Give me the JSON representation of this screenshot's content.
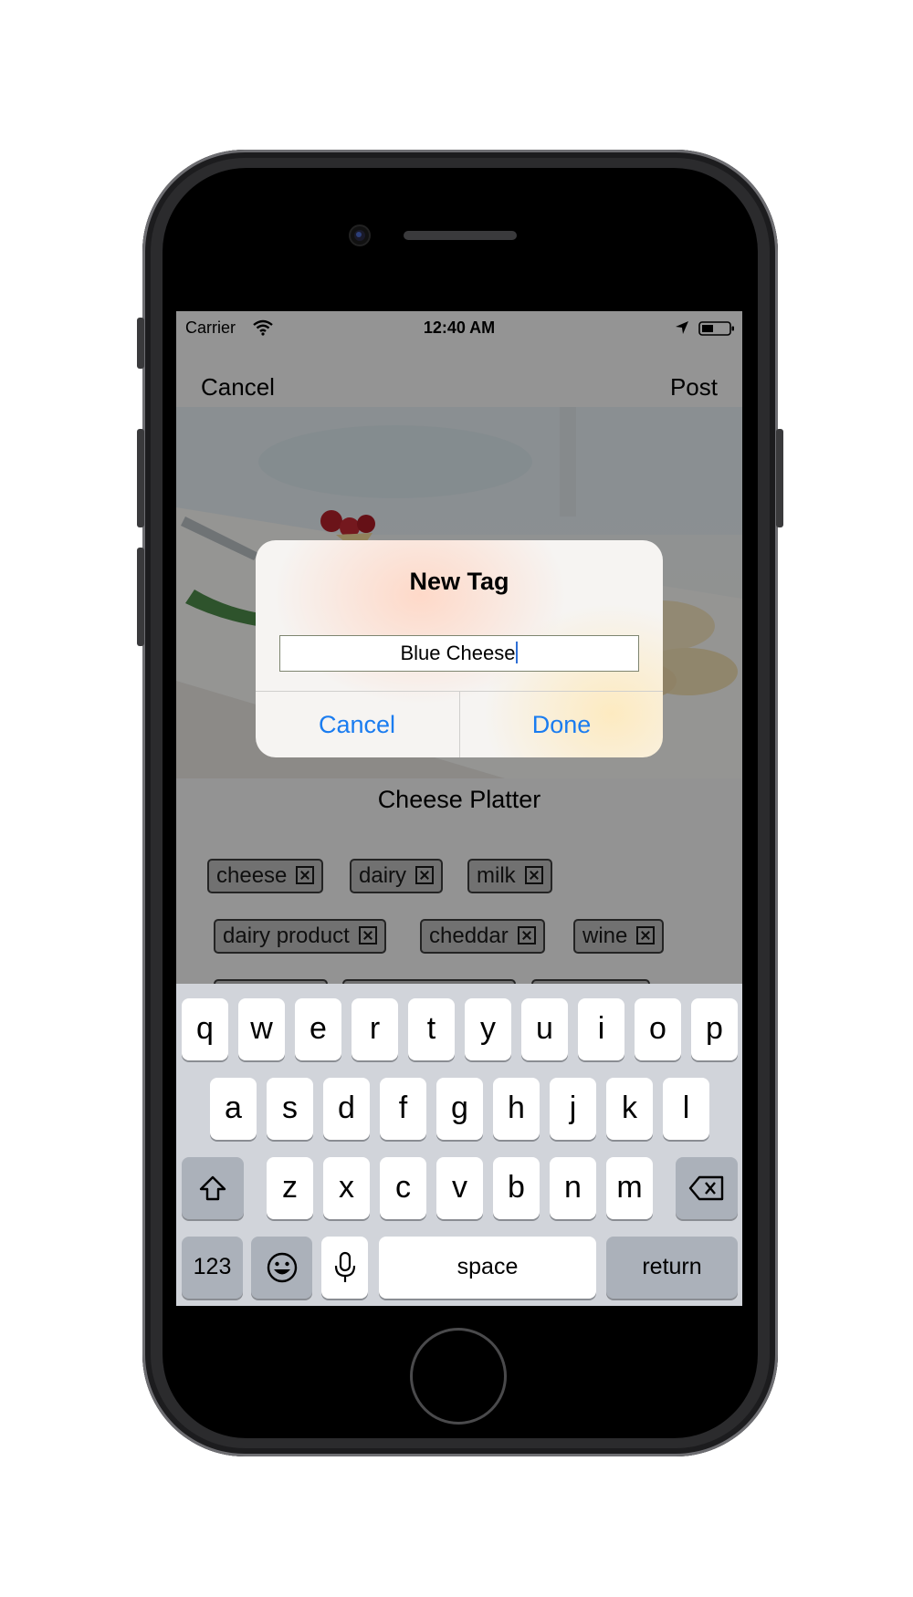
{
  "status_bar": {
    "carrier": "Carrier",
    "time": "12:40 AM"
  },
  "nav": {
    "cancel": "Cancel",
    "post": "Post"
  },
  "post": {
    "title": "Cheese Platter"
  },
  "tags": [
    "cheese",
    "dairy",
    "milk",
    "dairy product",
    "cheddar",
    "wine",
    "",
    "",
    ""
  ],
  "alert": {
    "title": "New Tag",
    "input_value": "Blue Cheese",
    "cancel": "Cancel",
    "done": "Done"
  },
  "keyboard": {
    "row1": [
      "q",
      "w",
      "e",
      "r",
      "t",
      "y",
      "u",
      "i",
      "o",
      "p"
    ],
    "row2": [
      "a",
      "s",
      "d",
      "f",
      "g",
      "h",
      "j",
      "k",
      "l"
    ],
    "row3": [
      "z",
      "x",
      "c",
      "v",
      "b",
      "n",
      "m"
    ],
    "numbers": "123",
    "space": "space",
    "return": "return"
  },
  "colors": {
    "accent": "#1a7cf0",
    "dim_overlay": "rgba(0,0,0,0.4)",
    "keyboard_bg": "#d1d4da"
  }
}
